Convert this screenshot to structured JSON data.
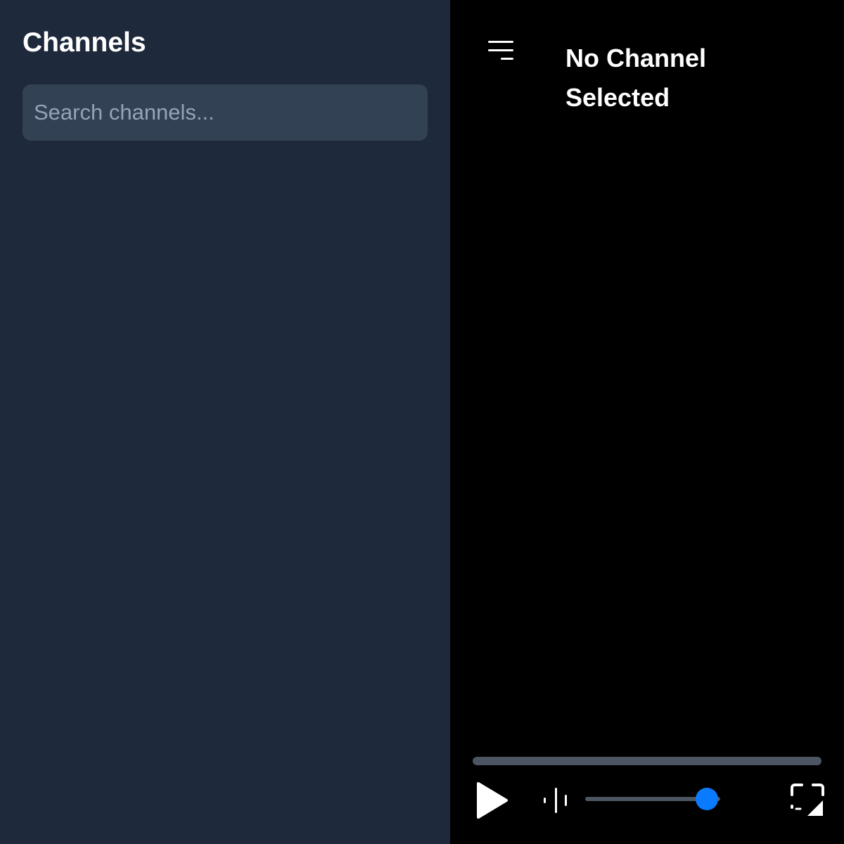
{
  "sidebar": {
    "title": "Channels",
    "search": {
      "placeholder": "Search channels...",
      "value": ""
    }
  },
  "player": {
    "title": "No Channel Selected",
    "progress": 0,
    "volume": 0.9,
    "icons": {
      "menu": "menu-lines-icon",
      "play": "play-icon",
      "volume": "volume-bars-icon",
      "fullscreen": "fullscreen-icon"
    }
  },
  "colors": {
    "sidebar_bg": "#1e293b",
    "search_bg": "#334155",
    "player_bg": "#000000",
    "track": "#4b5563",
    "accent": "#0a7aff",
    "text": "#ffffff",
    "placeholder": "#94a3b8"
  }
}
